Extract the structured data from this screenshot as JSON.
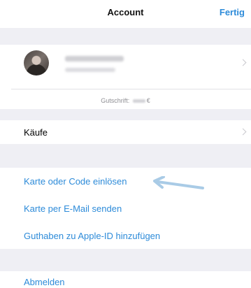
{
  "nav": {
    "title": "Account",
    "done_label": "Fertig"
  },
  "profile": {
    "credit_label": "Gutschrift:",
    "credit_currency": "€"
  },
  "purchases_label": "Käufe",
  "redeem_label": "Karte oder Code einlösen",
  "email_card_label": "Karte per E-Mail senden",
  "add_funds_label": "Guthaben zu Apple-ID hinzufügen",
  "sign_out_label": "Abmelden",
  "colors": {
    "accent": "#2d8bd9",
    "background": "#efeff4",
    "arrow": "#a9cbe6"
  }
}
